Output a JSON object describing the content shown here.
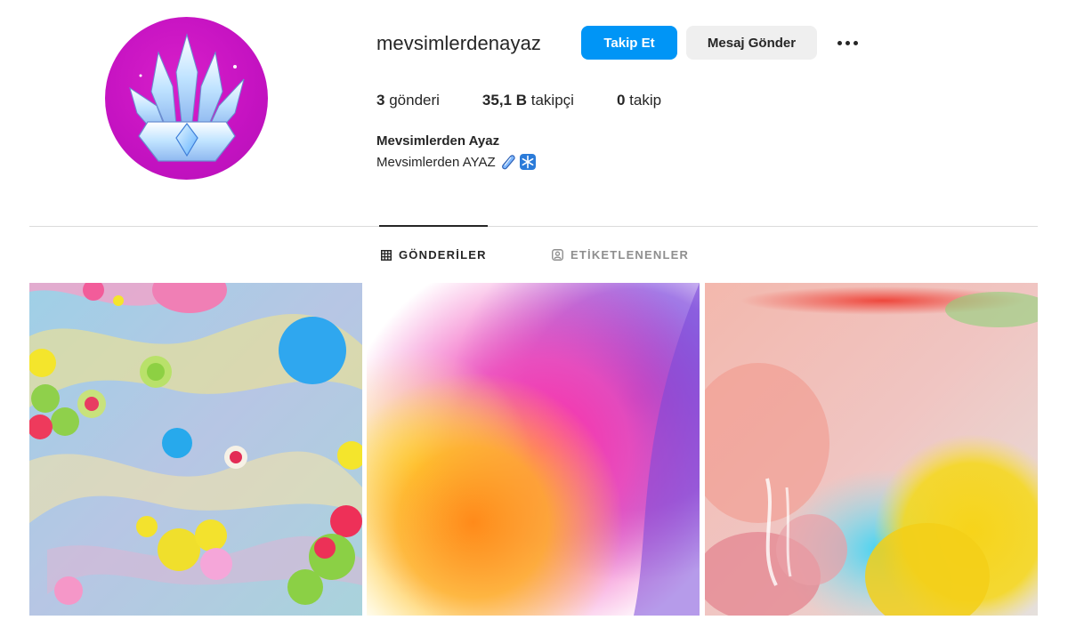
{
  "profile": {
    "username": "mevsimlerdenayaz",
    "full_name": "Mevsimlerden Ayaz",
    "bio": "Mevsimlerden AYAZ",
    "bio_icons": [
      "ice-stick-icon",
      "snowflake-icon"
    ],
    "avatar_icon": "ice-crown-icon"
  },
  "actions": {
    "follow_label": "Takip Et",
    "message_label": "Mesaj Gönder",
    "more_icon": "ellipsis-icon"
  },
  "stats": {
    "posts_count": "3",
    "posts_label": "gönderi",
    "followers_count": "35,1 B",
    "followers_label": "takipçi",
    "following_count": "0",
    "following_label": "takip"
  },
  "tabs": [
    {
      "label": "GÖNDERİLER",
      "icon": "grid-icon",
      "active": true
    },
    {
      "label": "ETİKETLENENLER",
      "icon": "tagged-icon",
      "active": false
    }
  ],
  "colors": {
    "accent": "#0095f6",
    "avatar_bg": "#c613c2",
    "text": "#262626",
    "muted": "#8e8e8e"
  },
  "posts": [
    {
      "name": "post-colorful-bubbles"
    },
    {
      "name": "post-color-powder-explosion"
    },
    {
      "name": "post-ink-in-water"
    }
  ]
}
